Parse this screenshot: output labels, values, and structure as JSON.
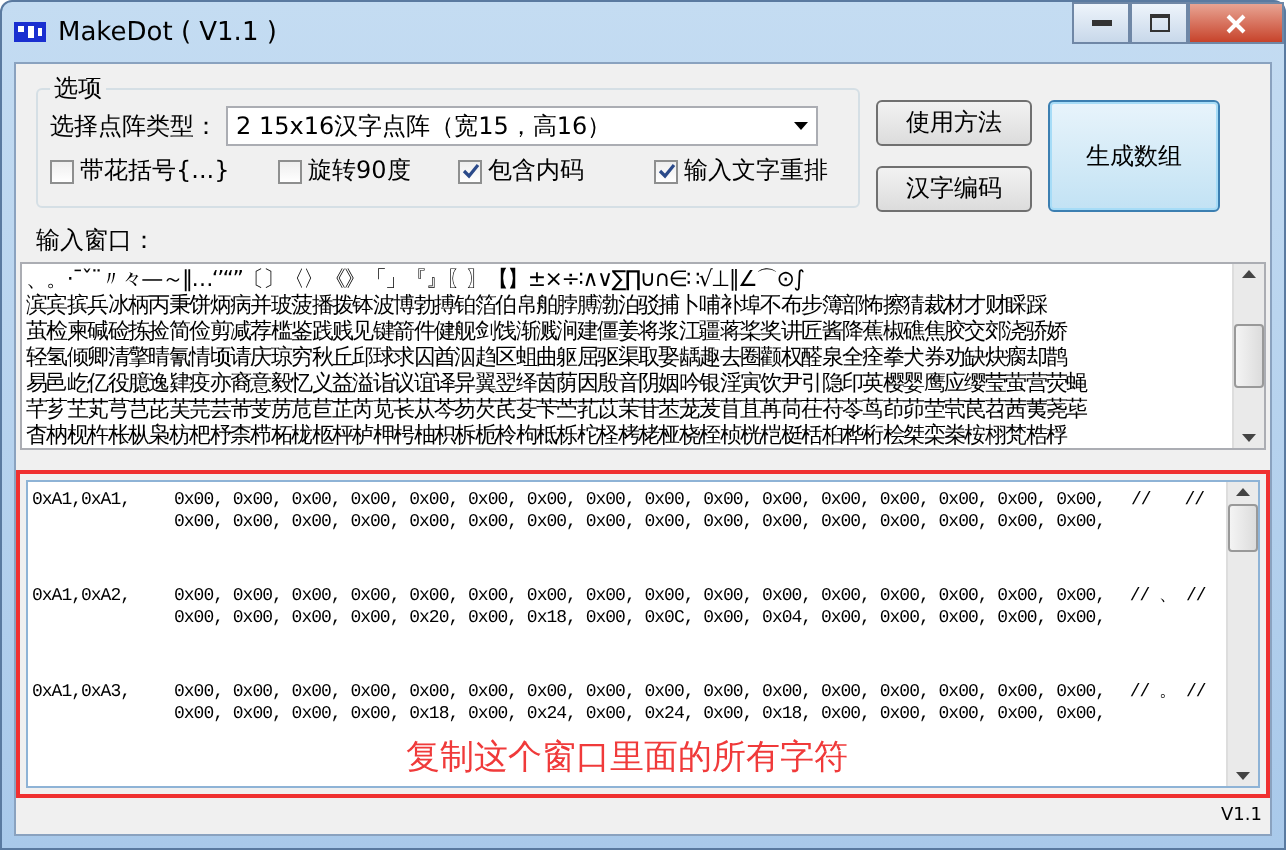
{
  "window": {
    "title": "MakeDot ( V1.1 )"
  },
  "options": {
    "group_title": "选项",
    "type_label": "选择点阵类型：",
    "type_value": "2 15x16汉字点阵（宽15，高16）",
    "checkboxes": [
      {
        "label": "带花括号{...}",
        "checked": false
      },
      {
        "label": "旋转90度",
        "checked": false
      },
      {
        "label": "包含内码",
        "checked": true
      },
      {
        "label": "输入文字重排",
        "checked": true
      }
    ]
  },
  "buttons": [
    {
      "label": "使用方法",
      "kind": "normal"
    },
    {
      "label": "汉字编码",
      "kind": "normal"
    },
    {
      "label": "生成数组",
      "kind": "default"
    }
  ],
  "input": {
    "label": "输入窗口：",
    "lines": [
      " 、。·ˉˇ¨〃々—～‖…‘’“”〔〕〈〉《》「」『』〖〗【】±×÷∶∧∨∑∏∪∩∈∷√⊥∥∠⌒⊙∫",
      "滨宾摈兵冰柄丙秉饼炳病并玻菠播拨钵波博勃搏铂箔伯帛舶脖膊渤泊驳捕卜哺补埠不布步簿部怖擦猜裁材才财睬踩",
      "茧检柬碱硷拣捡简俭剪减荐槛鉴践贱见键箭件健舰剑饯渐溅涧建僵姜将浆江疆蒋桨奖讲匠酱降蕉椒礁焦胶交郊浇骄娇",
      "轻氢倾卿清擎晴氰情顷请庆琼穷秋丘邱球求囚酋泅趋区蛆曲躯屈驱渠取娶龋趣去圈颧权醛泉全痊拳犬券劝缺炔瘸却鹊",
      "易邑屹亿役臆逸肄疫亦裔意毅忆义益溢诣议谊译异翼翌绎茵荫因殷音阴姻吟银淫寅饮尹引隐印英樱婴鹰应缨莹萤营荧蝇",
      "芊芗芏芄芎芑芘芙芫芸芾芰苈苊苣芷芮苋苌苁芩芴芡芪芟苄苎芤苡茉苷苤茏茇苜苴苒苘茌苻苓茑茚茆茔茕苠苕茜荑荛荜",
      "杳枘枧杵枨枞枭枋杷杼柰栉柘栊柩枰栌柙枵柚枳柝栀柃枸柢栎柁柽栲栳桠桡桎桢桄桤梃栝桕桦桁桧桀栾桊桉栩梵梏桴"
    ]
  },
  "output": {
    "entries": [
      {
        "code": "0xA1,0xA1,",
        "row_1": "0x00, 0x00, 0x00, 0x00, 0x00, 0x00, 0x00, 0x00, 0x00, 0x00, 0x00, 0x00, 0x00, 0x00, 0x00, 0x00,",
        "comment": "//　　//",
        "row_2": "0x00, 0x00, 0x00, 0x00, 0x00, 0x00, 0x00, 0x00, 0x00, 0x00, 0x00, 0x00, 0x00, 0x00, 0x00, 0x00,"
      },
      {
        "code": "0xA1,0xA2,",
        "row_1": "0x00, 0x00, 0x00, 0x00, 0x00, 0x00, 0x00, 0x00, 0x00, 0x00, 0x00, 0x00, 0x00, 0x00, 0x00, 0x00,",
        "comment": "// 、 //",
        "row_2": "0x00, 0x00, 0x00, 0x00, 0x20, 0x00, 0x18, 0x00, 0x0C, 0x00, 0x04, 0x00, 0x00, 0x00, 0x00, 0x00,"
      },
      {
        "code": "0xA1,0xA3,",
        "row_1": "0x00, 0x00, 0x00, 0x00, 0x00, 0x00, 0x00, 0x00, 0x00, 0x00, 0x00, 0x00, 0x00, 0x00, 0x00, 0x00,",
        "comment": "// 。 //",
        "row_2": "0x00, 0x00, 0x00, 0x00, 0x18, 0x00, 0x24, 0x00, 0x24, 0x00, 0x18, 0x00, 0x00, 0x00, 0x00, 0x00,"
      }
    ],
    "annotation": "复制这个窗口里面的所有字符"
  },
  "status_bar": {
    "text": "V1.1"
  }
}
